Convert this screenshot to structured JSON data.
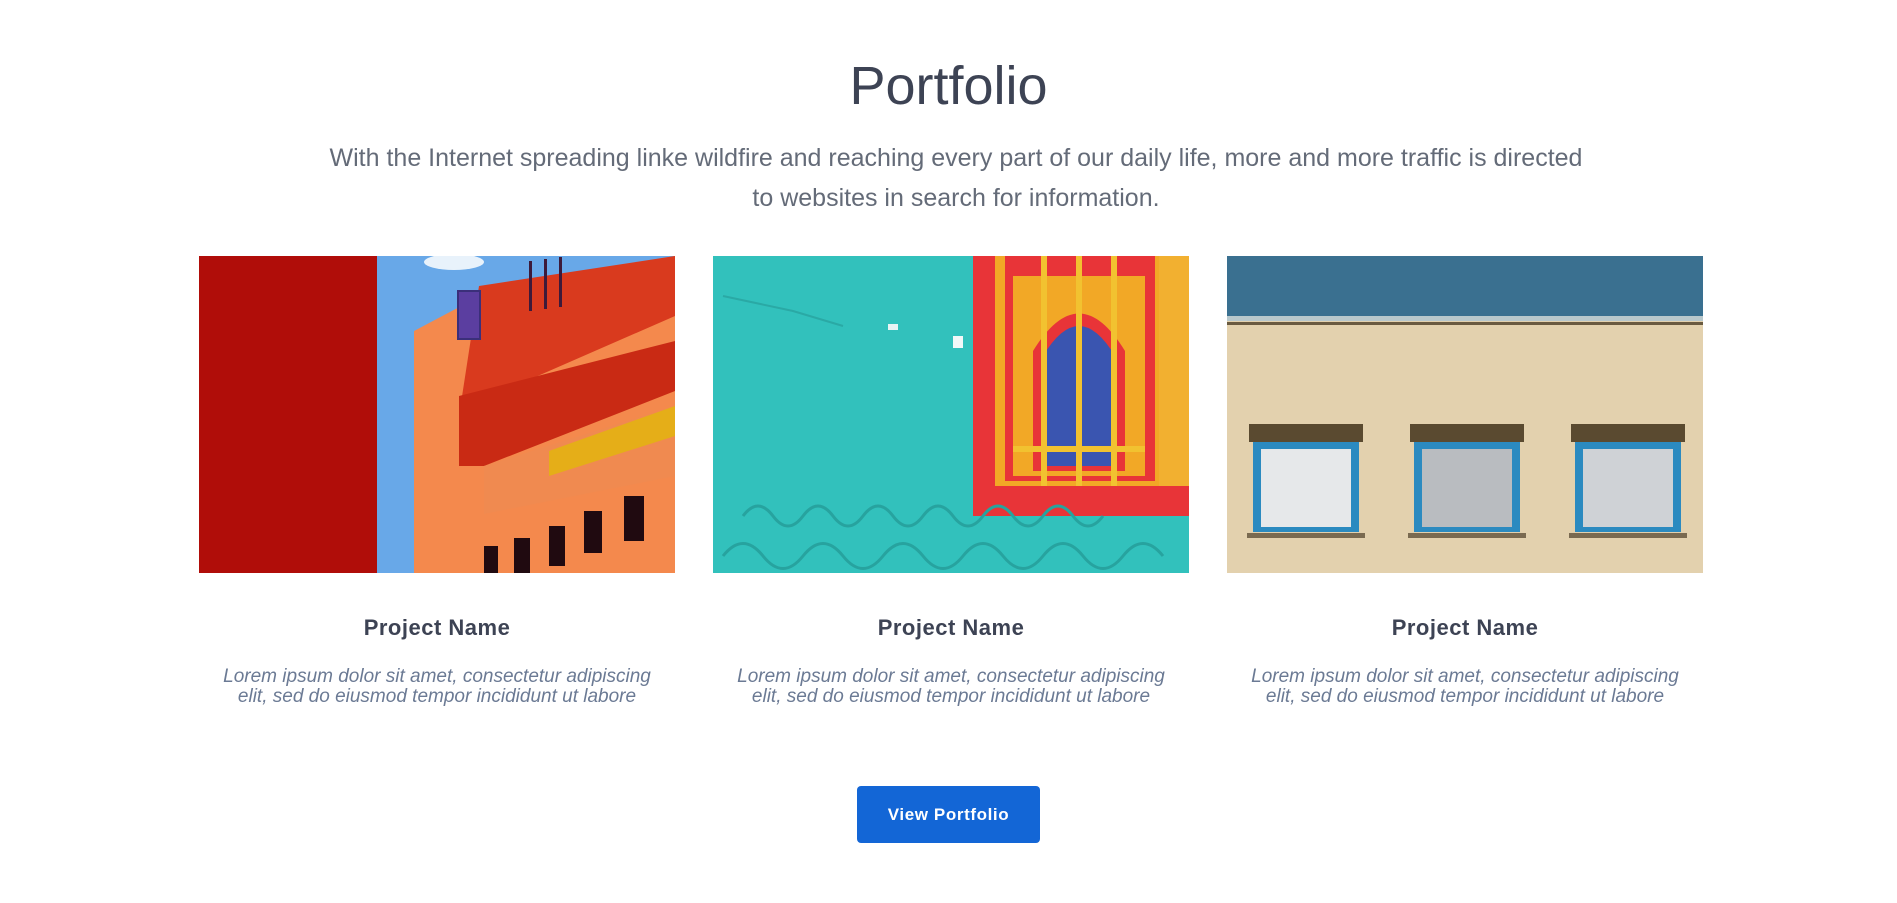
{
  "section": {
    "title": "Portfolio",
    "subtitle": "With the Internet spreading linke wildfire and reaching every part of our daily life, more and more traffic is directed to websites in search for information."
  },
  "projects": [
    {
      "name": "Project Name",
      "description": "Lorem ipsum dolor sit amet, consectetur adipiscing elit, sed do eiusmod tempor incididunt ut labore",
      "image_icon": "red-orange-building-photo"
    },
    {
      "name": "Project Name",
      "description": "Lorem ipsum dolor sit amet, consectetur adipiscing elit, sed do eiusmod tempor incididunt ut labore",
      "image_icon": "turquoise-wall-window-photo"
    },
    {
      "name": "Project Name",
      "description": "Lorem ipsum dolor sit amet, consectetur adipiscing elit, sed do eiusmod tempor incididunt ut labore",
      "image_icon": "beige-facade-windows-photo"
    }
  ],
  "cta": {
    "label": "View Portfolio",
    "color": "#1366d6"
  }
}
